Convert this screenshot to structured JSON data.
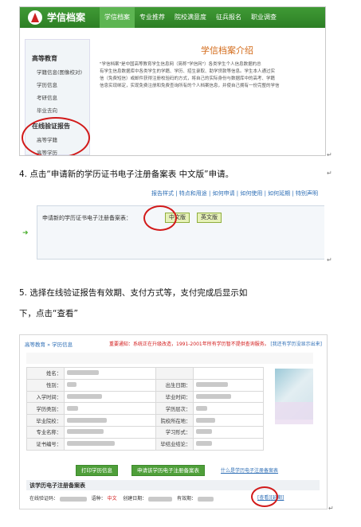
{
  "shot1": {
    "site_title": "学信档案",
    "nav": [
      "学信档案",
      "专业推荐",
      "院校满意度",
      "征兵报名",
      "职业调查"
    ],
    "sidebar": {
      "section1": "高等教育",
      "items1": [
        "学籍信息(图像校对)",
        "学历信息",
        "考研信息",
        "毕业去向"
      ],
      "section2": "在线验证报告",
      "items2": [
        "高等学籍",
        "高等学历"
      ]
    },
    "intro_title": "学信档案介绍",
    "intro_lines": [
      "\"学信档案\"是中国高等教育学生信息网（简称\"学信网\"）各类学生个人信息数据的总",
      "有学生信息数据库中各类学生的学籍、学历、招生录取、助学贷款等信息。学生本人通过实",
      "信（免费短信）或邮件获得注册校验码的方式，将自己的实际身份与数据库中的高考、学籍",
      "信息实现绑定，实现免费注册和免费查询所有的个人档案信息，并使自己拥有一份完整的学信"
    ]
  },
  "step4": "4. 点击“申请新的学历证书电子注册备案表 中文版”申请。",
  "shot2": {
    "links": "报告样式 | 特点和用途 | 如何申请 | 如何使用 | 如何延期 | 特别声明",
    "apply_label": "申请新的学历证书电子注册备案表：",
    "btn_cn": "中文版",
    "btn_en": "英文版"
  },
  "step5_line1": "5. 选择在线验证报告有效期、支付方式等，支付完成后显示如",
  "step5_line2": "下，点击“查看”",
  "shot3": {
    "crumb": "高等教育 » 学历信息",
    "notice": "重要通知：系统正在升级改造，1991-2001年所有学历暂不提供查询服务。",
    "right_link": "[我还有学历没显示出来]",
    "rows": [
      {
        "k1": "姓名：",
        "k2": ""
      },
      {
        "k1": "性别：",
        "k2": "出生日期："
      },
      {
        "k1": "入学时间：",
        "k2": "毕业时间："
      },
      {
        "k1": "学历类别：",
        "k2": "学历层次："
      },
      {
        "k1": "毕业院校：",
        "k2": "院校所在地："
      },
      {
        "k1": "专业名称：",
        "k2": "学习形式："
      },
      {
        "k1": "证书编号：",
        "k2": "毕结业结论："
      }
    ],
    "btn_print": "打印学历信息",
    "btn_apply": "申请该学历电子注册备案表",
    "link_what": "什么是学历电子注册备案表",
    "section_title": "该学历电子注册备案表",
    "code_label": "在线验证码：",
    "lang_label": "语种：",
    "lang_value": "中文",
    "created_label": "创建日期：",
    "valid_label": "有效期：",
    "view_link": "[查看]",
    "extend_link": "[延期]"
  },
  "return_mark": "↵",
  "colors": {
    "green": "#3f9a35",
    "red_mark": "#d21a1a",
    "link": "#2f6fb6"
  }
}
